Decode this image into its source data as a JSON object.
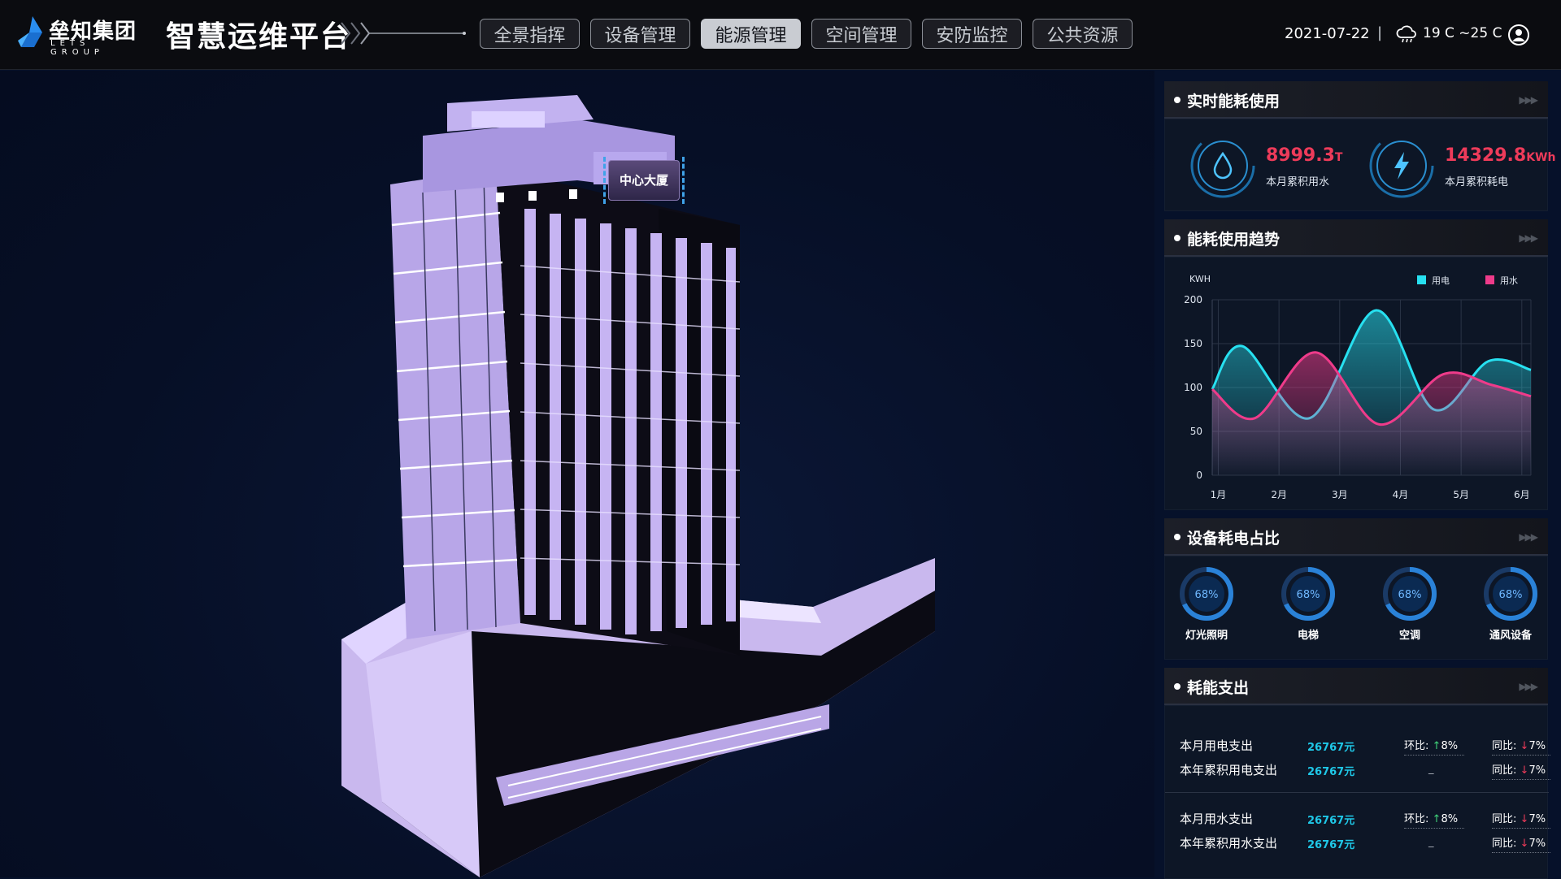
{
  "header": {
    "logo_cn": "垒知集团",
    "logo_en": "LETS GROUP",
    "platform_title": "智慧运维平台",
    "nav": [
      {
        "label": "全景指挥",
        "active": false
      },
      {
        "label": "设备管理",
        "active": false
      },
      {
        "label": "能源管理",
        "active": true
      },
      {
        "label": "空间管理",
        "active": false
      },
      {
        "label": "安防监控",
        "active": false
      },
      {
        "label": "公共资源",
        "active": false
      }
    ],
    "date": "2021-07-22",
    "separator": "|",
    "weather": "19 C ~25 C",
    "icons": {
      "weather": "cloud-rain-icon",
      "user": "user-icon"
    }
  },
  "scene": {
    "building_tag": "中心大厦"
  },
  "panel": {
    "realtime": {
      "title": "实时能耗使用",
      "water": {
        "value": "8999.3",
        "unit": "T",
        "label": "本月累积用水",
        "icon": "water-drop-icon"
      },
      "power": {
        "value": "14329.8",
        "unit": "KWh",
        "label": "本月累积耗电",
        "icon": "lightning-icon"
      }
    },
    "trend": {
      "title": "能耗使用趋势"
    },
    "device": {
      "title": "设备耗电占比",
      "items": [
        {
          "label": "灯光照明",
          "percent_text": "68%",
          "value": 68
        },
        {
          "label": "电梯",
          "percent_text": "68%",
          "value": 68
        },
        {
          "label": "空调",
          "percent_text": "68%",
          "value": 68
        },
        {
          "label": "通风设备",
          "percent_text": "68%",
          "value": 68
        }
      ]
    },
    "expense": {
      "title": "耗能支出",
      "rows": [
        {
          "name": "本月用电支出",
          "value": "26767元",
          "hb_label": "环比:",
          "hb_arrow": "↑",
          "hb_value": "8%",
          "hb_dir": "up",
          "tb_label": "同比:",
          "tb_arrow": "↓",
          "tb_value": "7%",
          "tb_dir": "down"
        },
        {
          "name": "本年累积用电支出",
          "value": "26767元",
          "hb_dash": "_",
          "tb_label": "同比:",
          "tb_arrow": "↓",
          "tb_value": "7%",
          "tb_dir": "down"
        },
        {
          "name": "本月用水支出",
          "value": "26767元",
          "hb_label": "环比:",
          "hb_arrow": "↑",
          "hb_value": "8%",
          "hb_dir": "up",
          "tb_label": "同比:",
          "tb_arrow": "↓",
          "tb_value": "7%",
          "tb_dir": "down"
        },
        {
          "name": "本年累积用水支出",
          "value": "26767元",
          "hb_dash": "_",
          "tb_label": "同比:",
          "tb_arrow": "↓",
          "tb_value": "7%",
          "tb_dir": "down"
        }
      ]
    }
  },
  "colors": {
    "electric": "#27e0f0",
    "water": "#ee3b8a",
    "alert_red": "#ee3b5a",
    "accent_cyan": "#1fc8e8"
  },
  "chart_data": {
    "type": "area",
    "ylabel": "KWH",
    "categories": [
      "1月",
      "2月",
      "3月",
      "4月",
      "5月",
      "6月"
    ],
    "ylim": [
      0,
      200
    ],
    "yticks": [
      0,
      50,
      100,
      150,
      200
    ],
    "series": [
      {
        "name": "用电",
        "color": "#27e0f0",
        "x": [
          1,
          1.6,
          2.6,
          4.2,
          5.2,
          6.0
        ],
        "points": [
          [
            0.9,
            98
          ],
          [
            1.4,
            147
          ],
          [
            2.5,
            65
          ],
          [
            3.6,
            188
          ],
          [
            4.55,
            75
          ],
          [
            5.45,
            130
          ],
          [
            6.15,
            120
          ]
        ]
      },
      {
        "name": "用水",
        "color": "#ee3b8a",
        "points": [
          [
            0.9,
            98
          ],
          [
            1.6,
            65
          ],
          [
            2.6,
            140
          ],
          [
            3.65,
            58
          ],
          [
            4.7,
            115
          ],
          [
            5.5,
            103
          ],
          [
            6.15,
            90
          ]
        ]
      }
    ],
    "legend_position": "top-right",
    "grid": true
  }
}
